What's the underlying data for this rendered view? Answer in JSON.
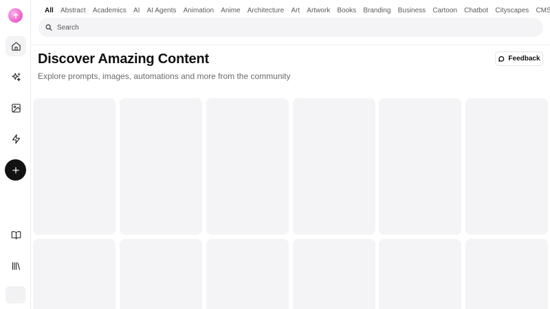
{
  "tabs": [
    "All",
    "Abstract",
    "Academics",
    "AI",
    "AI Agents",
    "Animation",
    "Anime",
    "Architecture",
    "Art",
    "Artwork",
    "Books",
    "Branding",
    "Business",
    "Cartoon",
    "Chatbot",
    "Cityscapes",
    "CMS / CRM"
  ],
  "active_tab": "All",
  "search": {
    "placeholder": "Search"
  },
  "header": {
    "title": "Discover Amazing Content",
    "subtitle": "Explore prompts, images, automations and more from the community",
    "feedback_label": "Feedback"
  },
  "sidebar": {
    "items": [
      {
        "icon": "home-icon",
        "active": true
      },
      {
        "icon": "sparkles-icon",
        "active": false
      },
      {
        "icon": "image-icon",
        "active": false
      },
      {
        "icon": "lightning-icon",
        "active": false
      },
      {
        "icon": "plus-icon",
        "active": false
      },
      {
        "icon": "book-open-icon",
        "active": false
      },
      {
        "icon": "library-icon",
        "active": false
      }
    ]
  },
  "colors": {
    "accent": "#f26bd0",
    "placeholder_card": "#f4f3f5",
    "create_button": "#121212"
  },
  "cards": {
    "rows": 2,
    "columns": 6
  }
}
